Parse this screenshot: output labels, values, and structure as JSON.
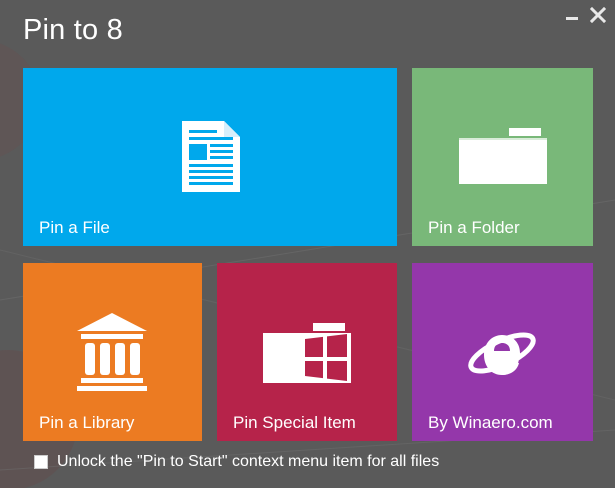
{
  "window": {
    "title": "Pin to 8",
    "minimize_icon": "minimize-icon",
    "close_icon": "close-icon"
  },
  "tiles": [
    {
      "id": "file",
      "label": "Pin a File",
      "color": "#00a8ec",
      "icon": "document-icon"
    },
    {
      "id": "folder",
      "label": "Pin a Folder",
      "color": "#79b879",
      "icon": "folder-icon"
    },
    {
      "id": "library",
      "label": "Pin a Library",
      "color": "#ec7b22",
      "icon": "library-icon"
    },
    {
      "id": "special",
      "label": "Pin Special Item",
      "color": "#b6234a",
      "icon": "windows-folder-icon"
    },
    {
      "id": "winaero",
      "label": "By Winaero.com",
      "color": "#9437aa",
      "icon": "internet-explorer-icon"
    }
  ],
  "checkbox": {
    "label": "Unlock the \"Pin to Start\" context menu item for all files",
    "checked": false
  }
}
